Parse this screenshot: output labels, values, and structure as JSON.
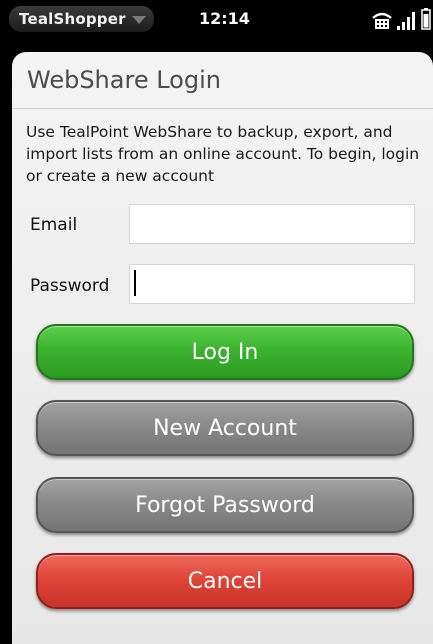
{
  "status_bar": {
    "app_menu_label": "TealShopper",
    "clock": "12:14"
  },
  "dialog": {
    "title": "WebShare Login",
    "description": "Use TealPoint WebShare to backup, export, and import lists from an online account. To begin, login or create a new account",
    "email": {
      "label": "Email",
      "value": ""
    },
    "password": {
      "label": "Password",
      "value": ""
    }
  },
  "buttons": {
    "login": "Log In",
    "new_account": "New Account",
    "forgot_password": "Forgot Password",
    "cancel": "Cancel"
  },
  "colors": {
    "login_button": "#3cb32f",
    "neutral_button": "#8a8a8a",
    "cancel_button": "#df4538"
  },
  "icons": {
    "app_menu": "chevron-down-icon",
    "network": "wifi-phone-icon",
    "signal": "signal-bars-icon",
    "battery": "battery-icon"
  }
}
